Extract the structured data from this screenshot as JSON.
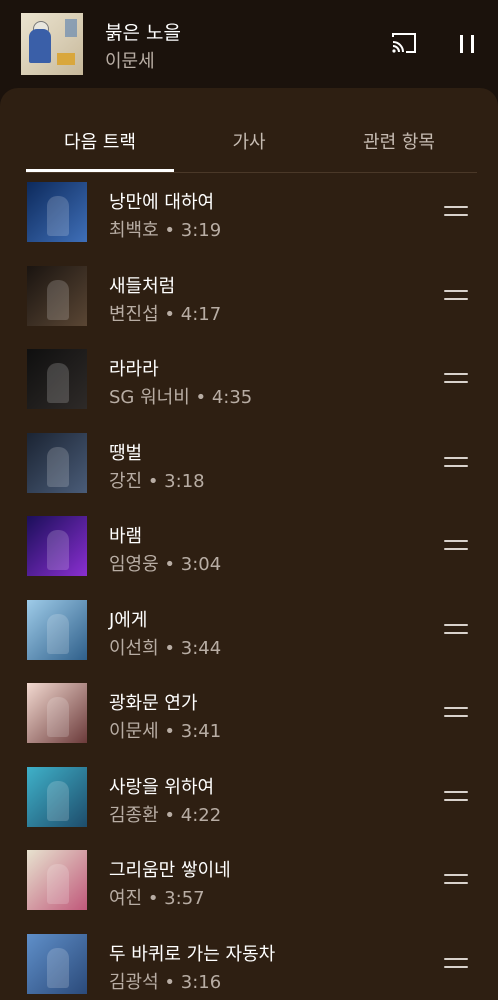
{
  "now_playing": {
    "title": "붉은 노을",
    "artist": "이문세",
    "cast_icon": "cast-icon",
    "pause_icon": "pause-icon"
  },
  "tabs": [
    {
      "label": "다음 트랙",
      "active": true
    },
    {
      "label": "가사",
      "active": false
    },
    {
      "label": "관련 항목",
      "active": false
    }
  ],
  "queue": [
    {
      "title": "낭만에 대하여",
      "subtitle": "최백호 • 3:19",
      "art_colors": [
        "#0d2a5c",
        "#3f6fb8"
      ]
    },
    {
      "title": "새들처럼",
      "subtitle": "변진섭 • 4:17",
      "art_colors": [
        "#1a1410",
        "#5a4634"
      ]
    },
    {
      "title": "라라라",
      "subtitle": "SG 워너비 • 4:35",
      "art_colors": [
        "#0f0f0f",
        "#2e2a28"
      ]
    },
    {
      "title": "땡벌",
      "subtitle": "강진 • 3:18",
      "art_colors": [
        "#1b2433",
        "#4a5c78"
      ]
    },
    {
      "title": "바램",
      "subtitle": "임영웅 • 3:04",
      "art_colors": [
        "#1b0f5a",
        "#8a2fd1"
      ]
    },
    {
      "title": "J에게",
      "subtitle": "이선희 • 3:44",
      "art_colors": [
        "#9ecbe8",
        "#2f5f8a"
      ]
    },
    {
      "title": "광화문 연가",
      "subtitle": "이문세 • 3:41",
      "art_colors": [
        "#f2d9d0",
        "#6b3a3a"
      ]
    },
    {
      "title": "사랑을 위하여",
      "subtitle": "김종환 • 4:22",
      "art_colors": [
        "#3fb1c9",
        "#1e4c6b"
      ]
    },
    {
      "title": "그리움만 쌓이네",
      "subtitle": "여진 • 3:57",
      "art_colors": [
        "#e7e2cf",
        "#c0587a"
      ]
    },
    {
      "title": "두 바퀴로 가는 자동차",
      "subtitle": "김광석 • 3:16",
      "art_colors": [
        "#5f8fc9",
        "#2b4a7a"
      ]
    }
  ]
}
